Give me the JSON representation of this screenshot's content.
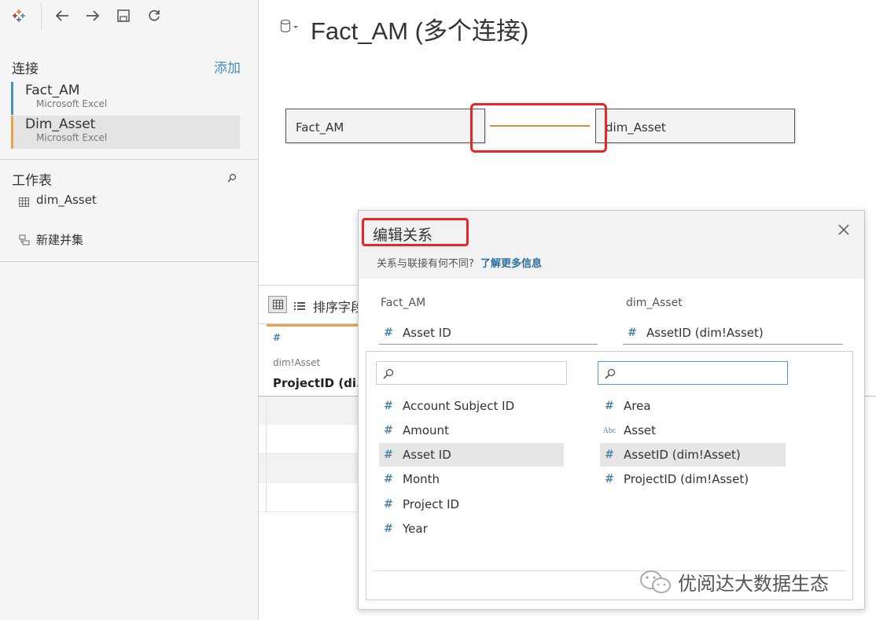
{
  "toolbar": {
    "logo_icon": "tableau-logo-icon",
    "back_icon": "back-arrow-icon",
    "forward_icon": "forward-arrow-icon",
    "save_icon": "save-icon",
    "refresh_icon": "refresh-icon"
  },
  "connections": {
    "title": "连接",
    "add_label": "添加",
    "items": [
      {
        "name": "Fact_AM",
        "type": "Microsoft Excel",
        "accent": "#4a90b8"
      },
      {
        "name": "Dim_Asset",
        "type": "Microsoft Excel",
        "accent": "#f0a04b"
      }
    ]
  },
  "worksheets": {
    "title": "工作表",
    "items": [
      {
        "label": "dim_Asset"
      }
    ],
    "new_union_label": "新建并集"
  },
  "datasource": {
    "title": "Fact_AM (多个连接)"
  },
  "canvas": {
    "left_table": "Fact_AM",
    "right_table": "dim_Asset",
    "relation_line_color": "#e8892f"
  },
  "grid": {
    "sort_label": "排序字段",
    "column": {
      "type_icon": "#",
      "source": "dim!Asset",
      "name": "ProjectID (di..."
    }
  },
  "dialog": {
    "title": "编辑关系",
    "subtitle": "关系与联接有何不同?",
    "learn_more": "了解更多信息",
    "left_header": "Fact_AM",
    "right_header": "dim_Asset",
    "left_selected": "Asset ID",
    "right_selected": "AssetID (dim!Asset)",
    "left_search_placeholder": "",
    "right_search_placeholder": "",
    "left_fields": [
      {
        "type": "#",
        "label": "Account Subject ID"
      },
      {
        "type": "#",
        "label": "Amount"
      },
      {
        "type": "#",
        "label": "Asset ID",
        "selected": true
      },
      {
        "type": "#",
        "label": "Month"
      },
      {
        "type": "#",
        "label": "Project ID"
      },
      {
        "type": "#",
        "label": "Year"
      }
    ],
    "right_fields": [
      {
        "type": "#",
        "label": "Area"
      },
      {
        "type": "Abc",
        "label": "Asset"
      },
      {
        "type": "#",
        "label": "AssetID (dim!Asset)",
        "selected": true
      },
      {
        "type": "#",
        "label": "ProjectID (dim!Asset)"
      }
    ]
  },
  "watermark": {
    "text": "优阅达大数据生态"
  },
  "highlight_color": "#e8262a"
}
